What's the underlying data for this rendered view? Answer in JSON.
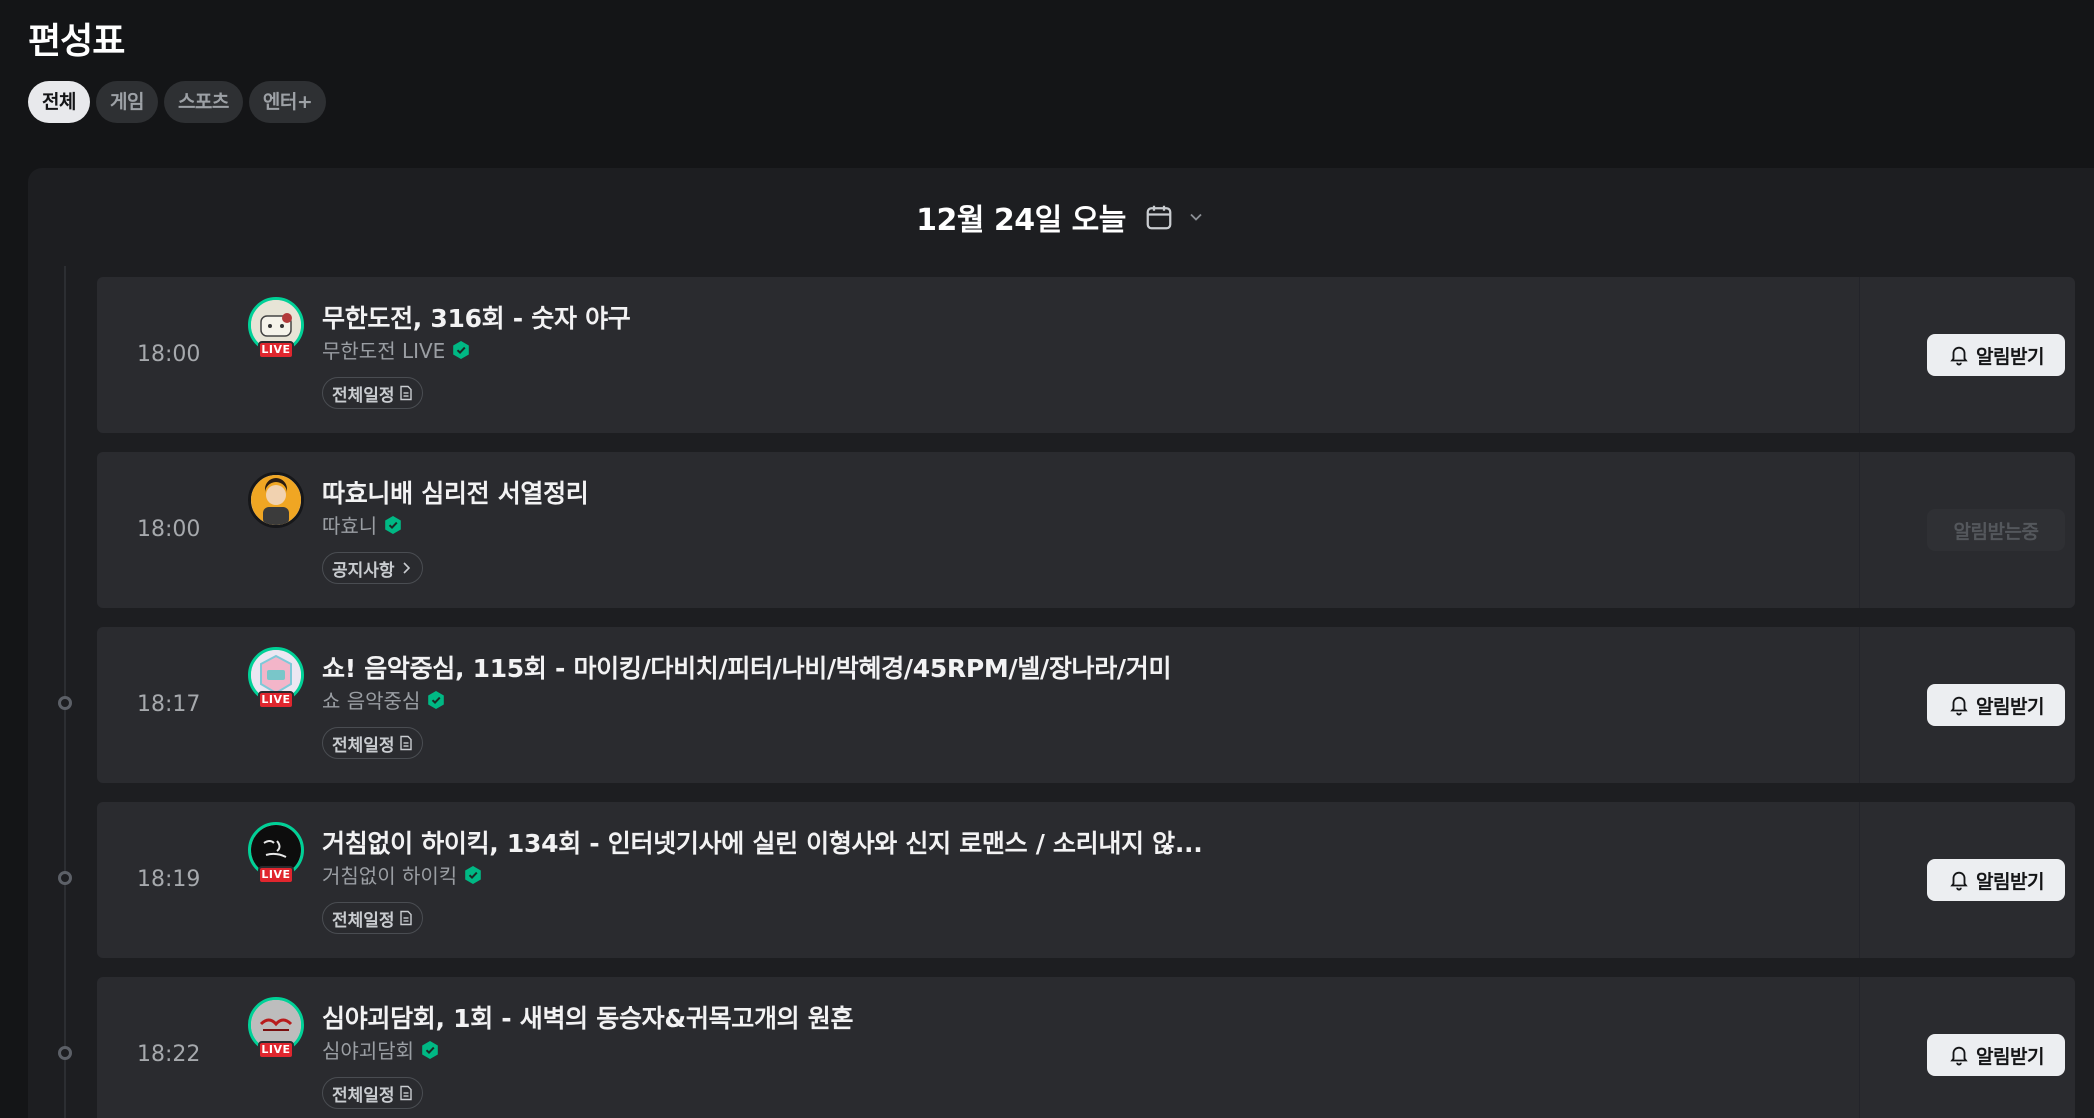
{
  "page": {
    "title": "편성표"
  },
  "filters": [
    {
      "label": "전체",
      "active": true
    },
    {
      "label": "게임",
      "active": false
    },
    {
      "label": "스포츠",
      "active": false
    },
    {
      "label": "엔터+",
      "active": false
    }
  ],
  "date_header": {
    "label": "12월 24일 오늘",
    "icon": "calendar-icon"
  },
  "colors": {
    "accent": "#00d197",
    "live": "#e0262e",
    "background": "#141517",
    "card": "#2a2b2f"
  },
  "schedule": [
    {
      "time": "18:00",
      "title": "무한도전, 316회 - 숫자 야구",
      "channel": "무한도전 LIVE",
      "live": true,
      "live_label": "LIVE",
      "tag": "전체일정",
      "tag_icon": "document-icon",
      "button": "알림받기",
      "button_disabled": false
    },
    {
      "time": "18:00",
      "title": "따효니배 심리전 서열정리",
      "channel": "따효니",
      "live": false,
      "live_label": "",
      "tag": "공지사항",
      "tag_icon": "chevron-right-icon",
      "button": "알림받는중",
      "button_disabled": true
    },
    {
      "time": "18:17",
      "title": "쇼! 음악중심, 115회 - 마이킹/다비치/피터/나비/박혜경/45RPM/넬/장나라/거미",
      "channel": "쇼 음악중심",
      "live": true,
      "live_label": "LIVE",
      "tag": "전체일정",
      "tag_icon": "document-icon",
      "button": "알림받기",
      "button_disabled": false
    },
    {
      "time": "18:19",
      "title": "거침없이 하이킥, 134회 - 인터넷기사에 실린 이형사와 신지 로맨스 / 소리내지 않...",
      "channel": "거침없이 하이킥",
      "live": true,
      "live_label": "LIVE",
      "tag": "전체일정",
      "tag_icon": "document-icon",
      "button": "알림받기",
      "button_disabled": false
    },
    {
      "time": "18:22",
      "title": "심야괴담회, 1회 - 새벽의 동승자&귀목고개의 원혼",
      "channel": "심야괴담회",
      "live": true,
      "live_label": "LIVE",
      "tag": "전체일정",
      "tag_icon": "document-icon",
      "button": "알림받기",
      "button_disabled": false
    }
  ]
}
